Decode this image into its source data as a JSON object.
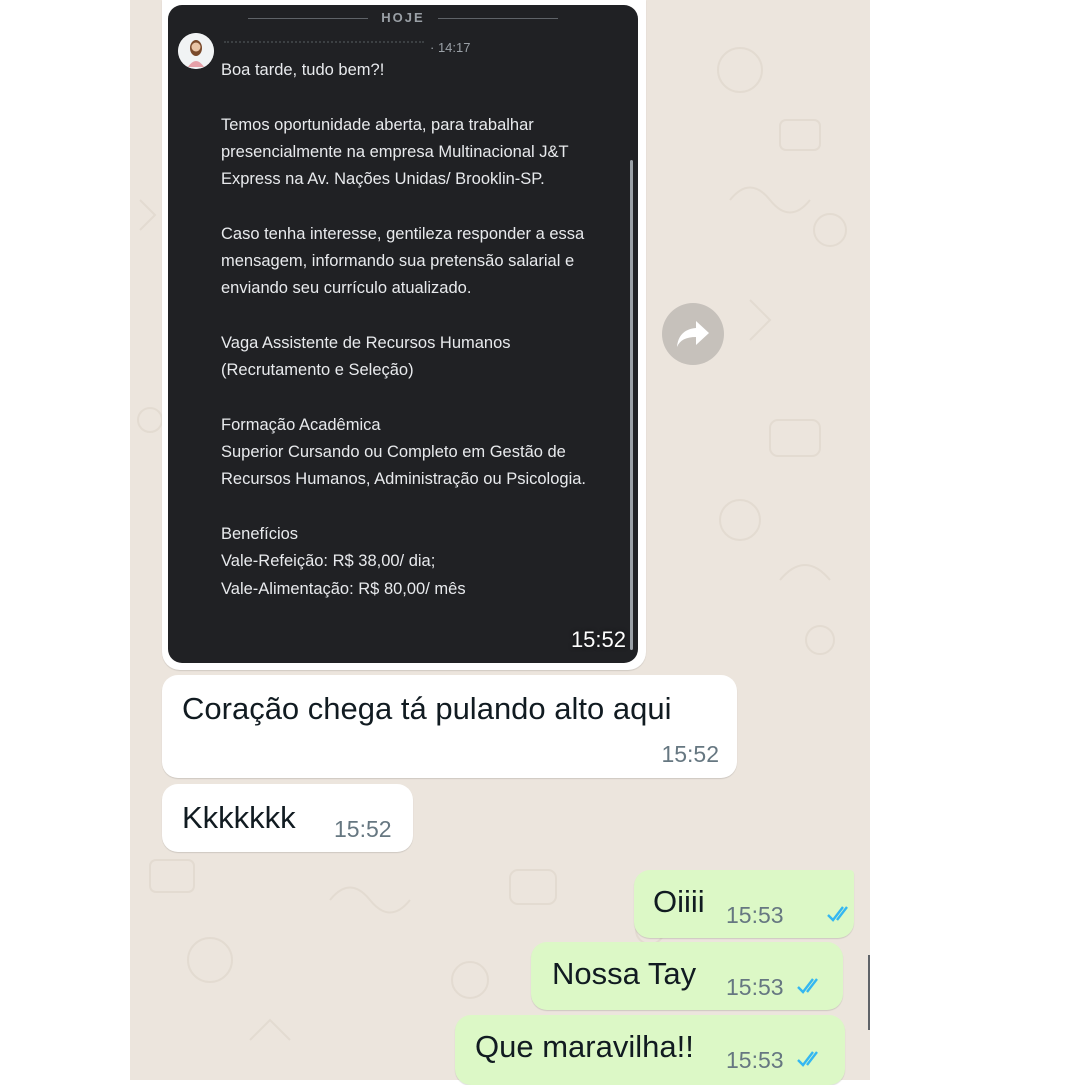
{
  "theme": {
    "chat_background": "#ece5dd",
    "incoming_bubble": "#ffffff",
    "outgoing_bubble": "#dcf8c6",
    "read_ticks": "#34b7f1"
  },
  "forwarded_image": {
    "day_divider": "HOJE",
    "inner_time": "· 14:17",
    "message_body": "Boa tarde, tudo bem?!\n\nTemos oportunidade aberta, para trabalhar presencialmente na empresa Multinacional J&T Express na Av. Nações Unidas/ Brooklin-SP.\n\nCaso tenha interesse, gentileza responder a essa mensagem, informando sua pretensão salarial e enviando seu currículo atualizado.\n\nVaga Assistente de Recursos Humanos (Recrutamento e Seleção)\n\nFormação Acadêmica\nSuperior Cursando ou Completo em Gestão de Recursos Humanos, Administração ou Psicologia.\n\nBenefícios\nVale-Refeição: R$ 38,00/ dia;\nVale-Alimentação: R$ 80,00/ mês",
    "time": "15:52",
    "forward_icon": "share-arrow-icon"
  },
  "messages": [
    {
      "direction": "in",
      "text": "Coração chega tá pulando alto aqui",
      "time": "15:52"
    },
    {
      "direction": "in",
      "text": "Kkkkkkk",
      "time": "15:52"
    },
    {
      "direction": "out",
      "text": "Oiiii",
      "time": "15:53",
      "status": "read-double-check-icon"
    },
    {
      "direction": "out",
      "text": "Nossa Tay",
      "time": "15:53",
      "status": "read-double-check-icon"
    },
    {
      "direction": "out",
      "text": "Que maravilha!!",
      "time": "15:53",
      "status": "read-double-check-icon"
    }
  ]
}
